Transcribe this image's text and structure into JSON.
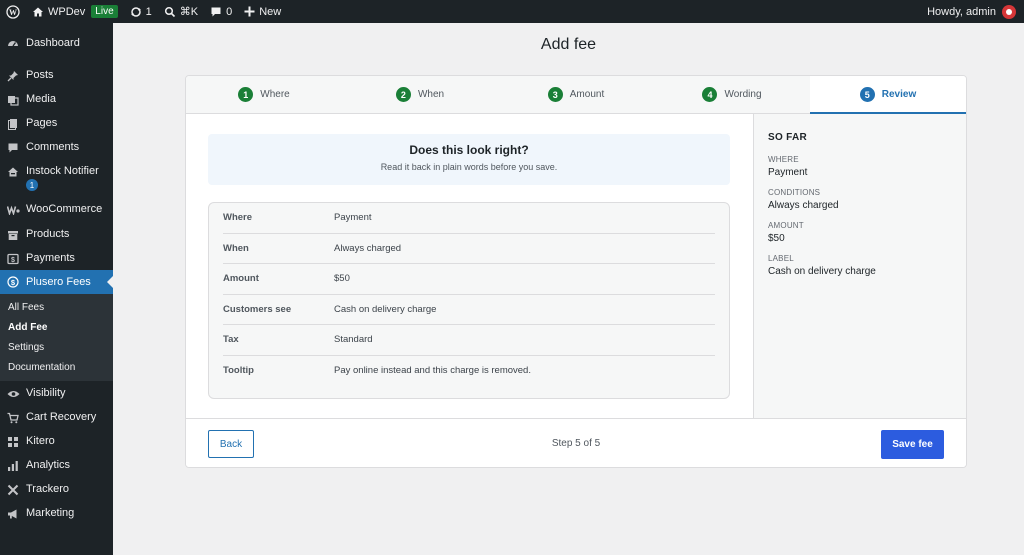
{
  "adminbar": {
    "site_name": "WPDev",
    "live_badge": "Live",
    "updates_count": "1",
    "search_shortcut": "⌘K",
    "comments_count": "0",
    "new_label": "New",
    "greeting": "Howdy, admin"
  },
  "sidebar": {
    "items": [
      {
        "label": "Dashboard",
        "icon": "dashboard-icon"
      },
      {
        "label": "Posts",
        "icon": "pin-icon"
      },
      {
        "label": "Media",
        "icon": "media-icon"
      },
      {
        "label": "Pages",
        "icon": "pages-icon"
      },
      {
        "label": "Comments",
        "icon": "comment-icon"
      },
      {
        "label": "Instock Notifier",
        "icon": "home-icon",
        "badge": "1"
      },
      {
        "label": "WooCommerce",
        "icon": "woo-icon"
      },
      {
        "label": "Products",
        "icon": "products-icon"
      },
      {
        "label": "Payments",
        "icon": "payments-icon"
      },
      {
        "label": "Plusero Fees",
        "icon": "dollar-icon"
      },
      {
        "label": "Visibility",
        "icon": "eye-icon"
      },
      {
        "label": "Cart Recovery",
        "icon": "cart-icon"
      },
      {
        "label": "Kitero",
        "icon": "grid-icon"
      },
      {
        "label": "Analytics",
        "icon": "bar-chart-icon"
      },
      {
        "label": "Trackero",
        "icon": "cross-icon"
      },
      {
        "label": "Marketing",
        "icon": "megaphone-icon"
      }
    ],
    "submenu": [
      "All Fees",
      "Add Fee",
      "Settings",
      "Documentation"
    ]
  },
  "page": {
    "title": "Add fee"
  },
  "steps": [
    {
      "num": "1",
      "label": "Where"
    },
    {
      "num": "2",
      "label": "When"
    },
    {
      "num": "3",
      "label": "Amount"
    },
    {
      "num": "4",
      "label": "Wording"
    },
    {
      "num": "5",
      "label": "Review"
    }
  ],
  "confirm": {
    "heading": "Does this look right?",
    "subtext": "Read it back in plain words before you save."
  },
  "review": [
    {
      "key": "Where",
      "value": "Payment"
    },
    {
      "key": "When",
      "value": "Always charged"
    },
    {
      "key": "Amount",
      "value": "$50"
    },
    {
      "key": "Customers see",
      "value": "Cash on delivery charge"
    },
    {
      "key": "Tax",
      "value": "Standard"
    },
    {
      "key": "Tooltip",
      "value": "Pay online instead and this charge is removed."
    }
  ],
  "so_far": {
    "title": "SO FAR",
    "items": [
      {
        "label": "WHERE",
        "value": "Payment"
      },
      {
        "label": "CONDITIONS",
        "value": "Always charged"
      },
      {
        "label": "AMOUNT",
        "value": "$50"
      },
      {
        "label": "LABEL",
        "value": "Cash on delivery charge"
      }
    ]
  },
  "footer": {
    "back_label": "Back",
    "step_text": "Step 5 of 5",
    "save_label": "Save fee"
  },
  "colors": {
    "accent": "#2271b1",
    "primary_button": "#2c5cdf",
    "step_done": "#1a7f37",
    "admin_dark": "#1d2327"
  }
}
